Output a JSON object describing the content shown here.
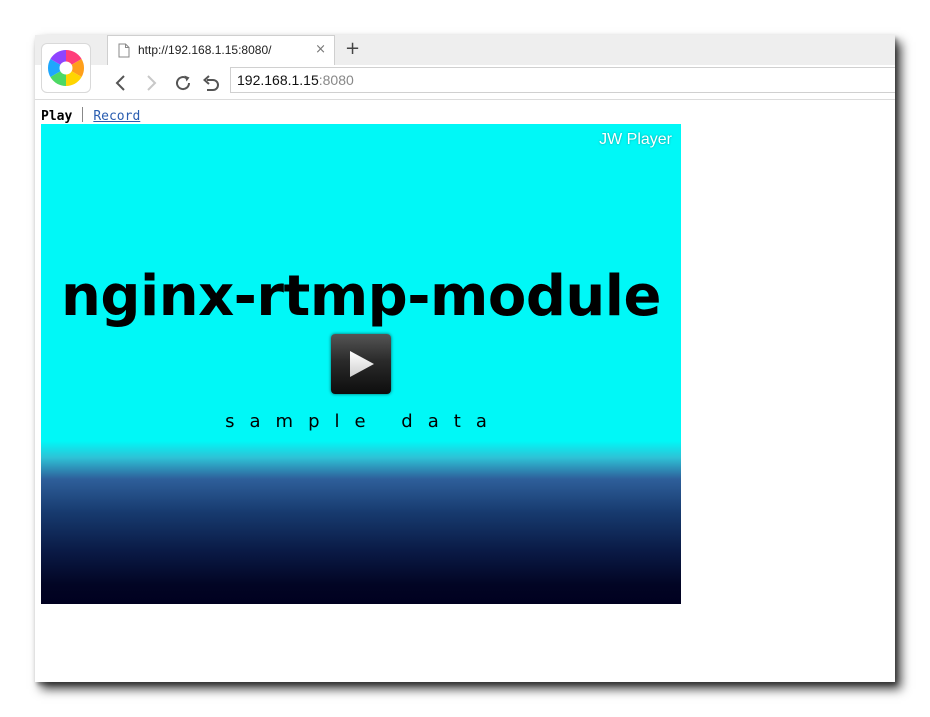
{
  "browser": {
    "tab": {
      "title": "http://192.168.1.15:8080/",
      "close": "×"
    },
    "new_tab": "+",
    "address": {
      "host": "192.168.1.15",
      "port": ":8080"
    }
  },
  "page": {
    "nav": {
      "play": "Play",
      "record": "Record"
    },
    "player": {
      "brand": "JW Player",
      "title": "nginx-rtmp-module",
      "subtitle": "sample data",
      "colors": {
        "top": "#00f8f7",
        "bottom": "#000020"
      }
    }
  }
}
